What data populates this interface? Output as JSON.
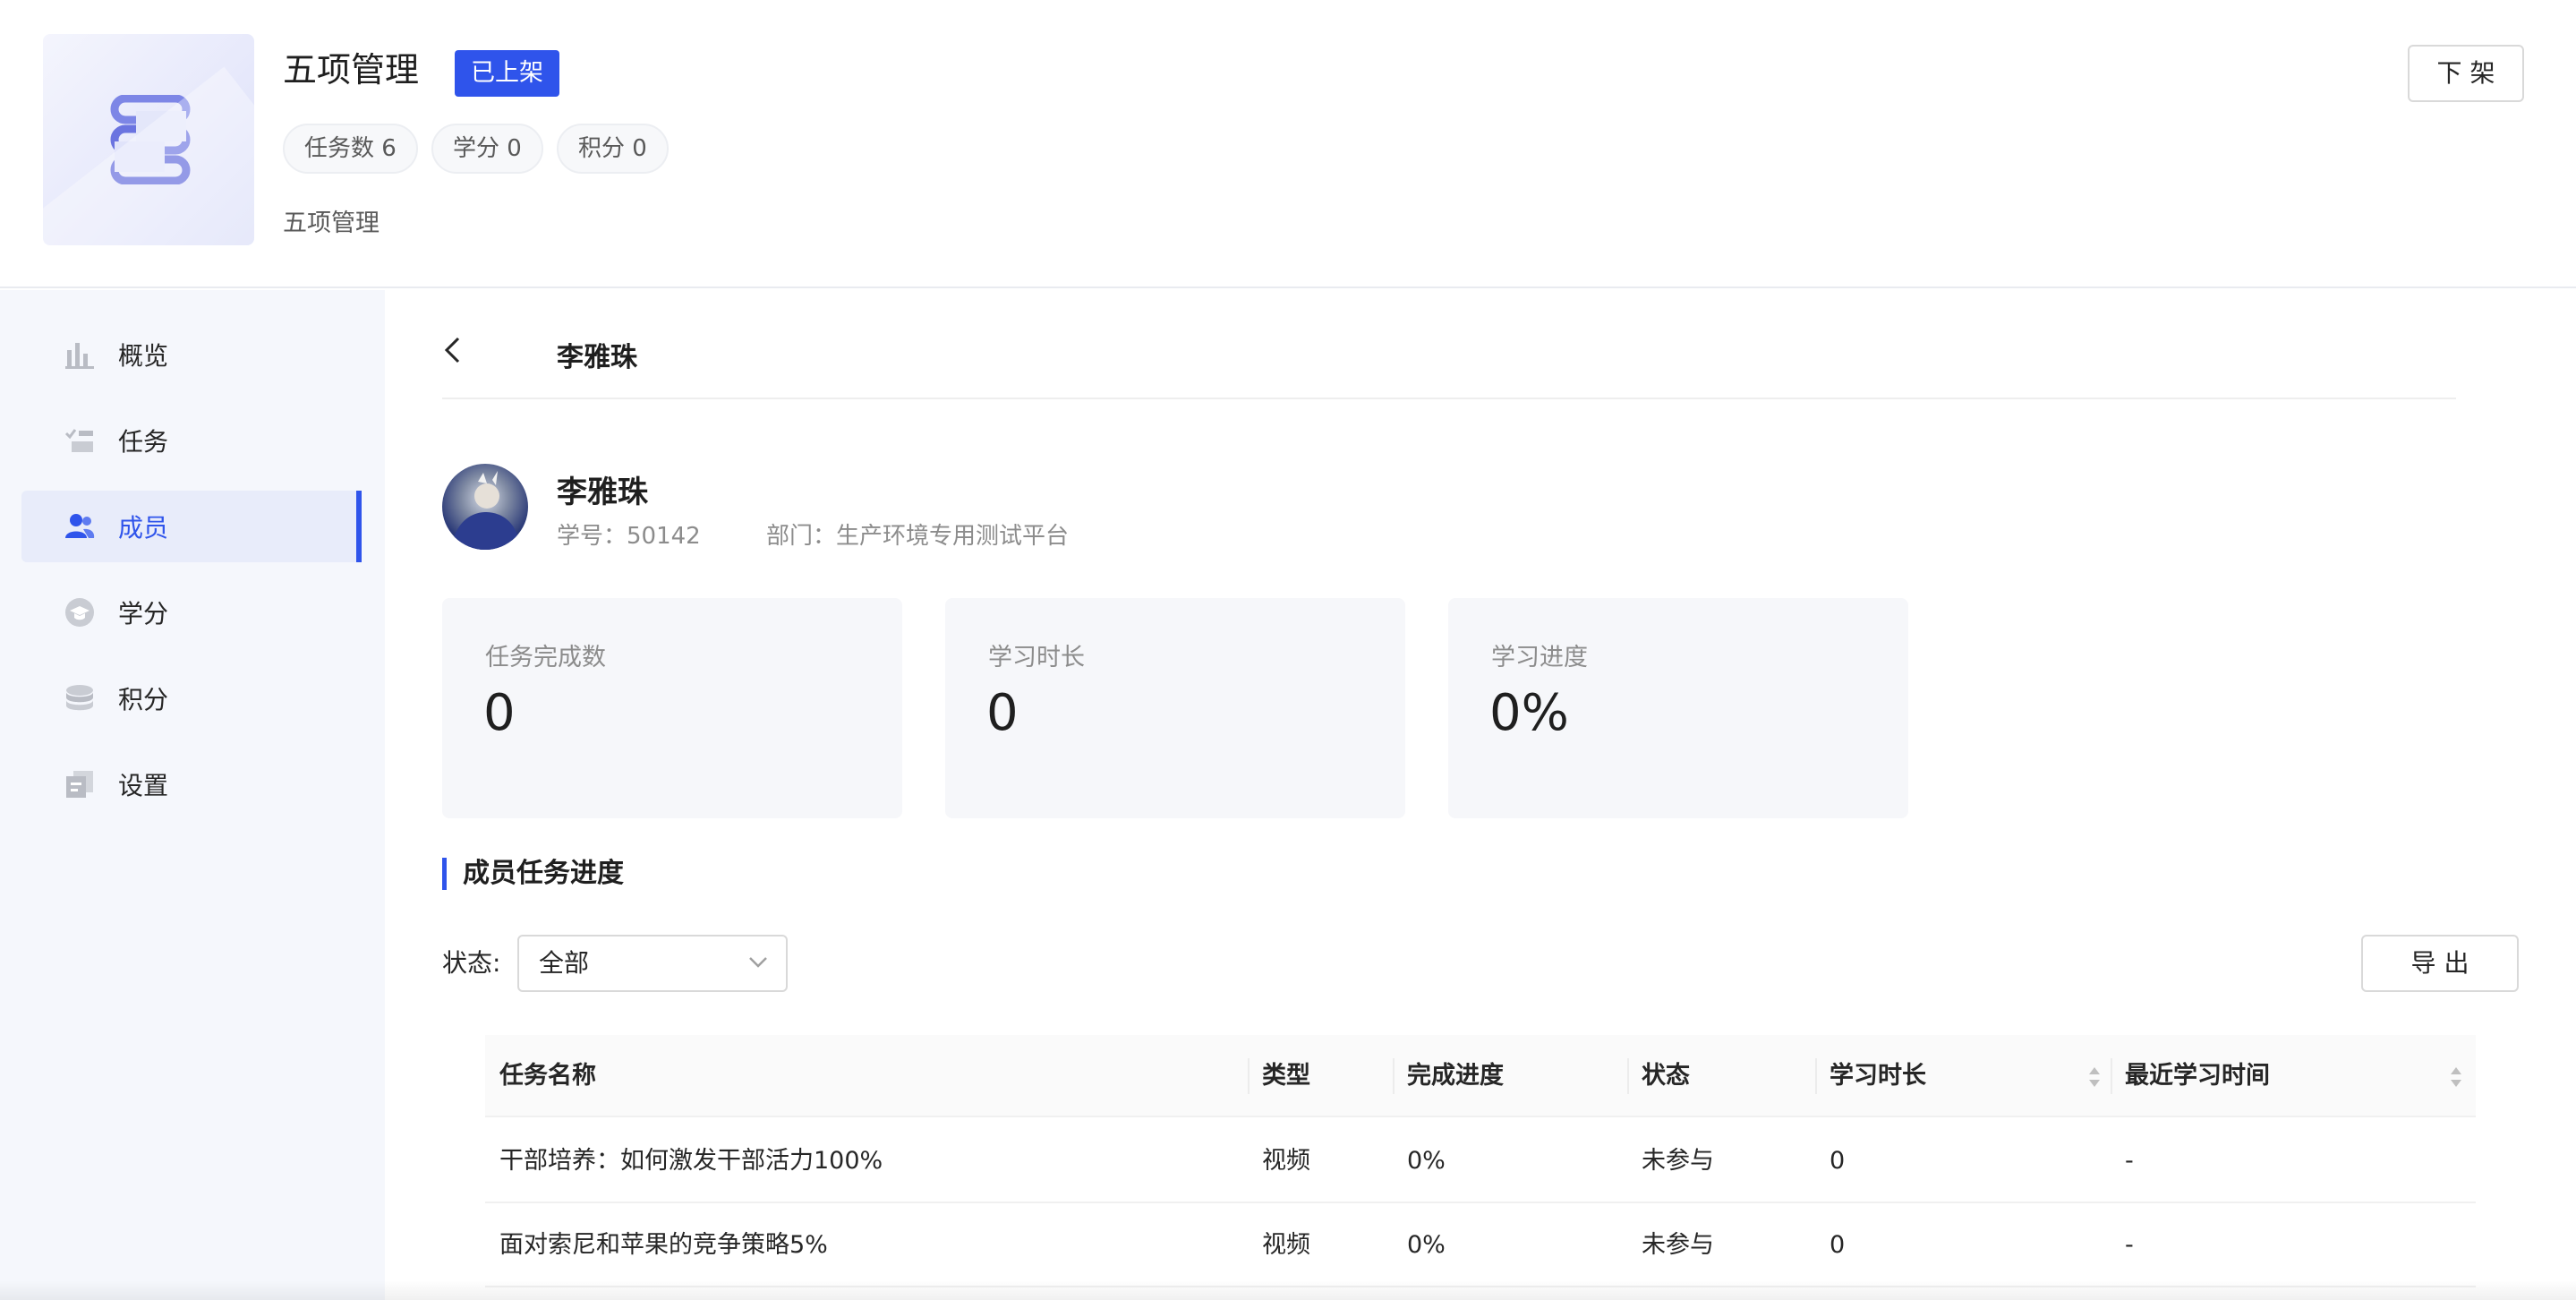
{
  "header": {
    "title": "五项管理",
    "status_tag": "已上架",
    "stats": [
      "任务数 6",
      "学分 0",
      "积分 0"
    ],
    "subtitle": "五项管理",
    "offline_button": "下 架"
  },
  "sidebar": {
    "items": [
      {
        "label": "概览",
        "icon": "bar-chart-icon"
      },
      {
        "label": "任务",
        "icon": "task-list-icon"
      },
      {
        "label": "成员",
        "icon": "users-icon",
        "active": true
      },
      {
        "label": "学分",
        "icon": "graduation-cap-icon"
      },
      {
        "label": "积分",
        "icon": "coin-stack-icon"
      },
      {
        "label": "设置",
        "icon": "settings-doc-icon"
      }
    ]
  },
  "detail": {
    "back_title": "李雅珠",
    "member": {
      "name": "李雅珠",
      "student_id": "学号：50142",
      "department": "部门：生产环境专用测试平台"
    },
    "cards": [
      {
        "label": "任务完成数",
        "value": "0"
      },
      {
        "label": "学习时长",
        "value": "0"
      },
      {
        "label": "学习进度",
        "value": "0%"
      }
    ],
    "section_title": "成员任务进度",
    "filter": {
      "label": "状态:",
      "value": "全部"
    },
    "export_button": "导 出",
    "table": {
      "columns": [
        "任务名称",
        "类型",
        "完成进度",
        "状态",
        "学习时长",
        "最近学习时间"
      ],
      "rows": [
        [
          "干部培养：如何激发干部活力100%",
          "视频",
          "0%",
          "未参与",
          "0",
          "-"
        ],
        [
          "面对索尼和苹果的竞争策略5%",
          "视频",
          "0%",
          "未参与",
          "0",
          "-"
        ]
      ]
    }
  },
  "colors": {
    "accent": "#2f54eb",
    "sidebar_bg": "#f5f7fc",
    "card_bg": "#f6f7fa"
  }
}
